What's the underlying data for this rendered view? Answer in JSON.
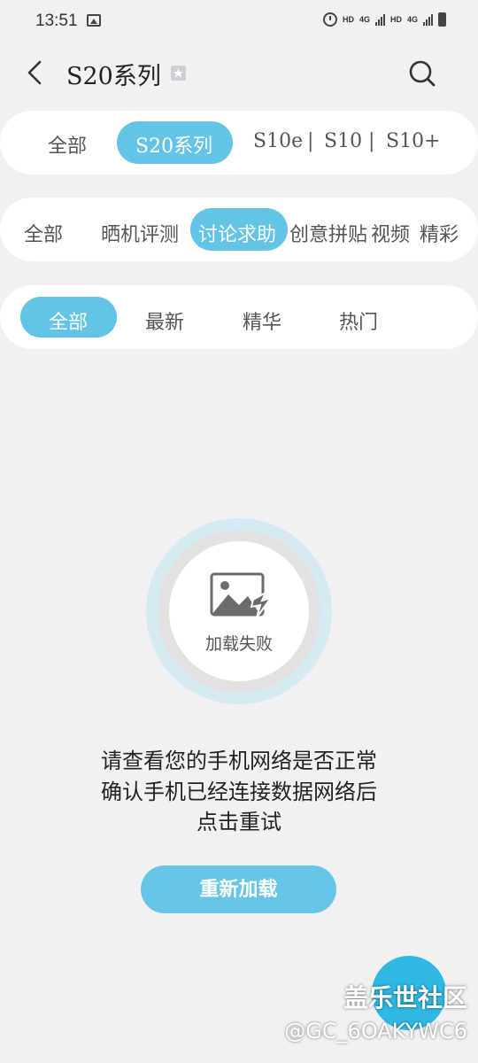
{
  "status_bar": {
    "time": "13:51",
    "hd1": "HD",
    "net1": "4G",
    "hd2": "HD",
    "net2": "4G"
  },
  "header": {
    "title": "S20系列",
    "back_icon": "chevron-left-icon",
    "favorite_icon": "star-bookmark-icon",
    "search_icon": "search-icon"
  },
  "series_tabs": {
    "items": [
      "全部",
      "S20系列",
      "S10e",
      "|",
      "S10",
      "|",
      "S10+"
    ],
    "selected": "S20系列"
  },
  "category_tabs": {
    "items": [
      "全部",
      "晒机评测",
      "讨论求助",
      "创意拼贴",
      "视频",
      "精彩"
    ],
    "selected": "讨论求助"
  },
  "sort_tabs": {
    "items": [
      "全部",
      "最新",
      "精华",
      "热门"
    ],
    "selected": "全部"
  },
  "error": {
    "image_label": "加载失败",
    "line1": "请查看您的手机网络是否正常",
    "line2": "确认手机已经连接数据网络后",
    "line3": "点击重试",
    "retry_button": "重新加载"
  },
  "watermark": {
    "brand": "盖乐世社区",
    "user": "@GC_6OAKYWC6"
  },
  "colors": {
    "accent": "#63c4e8",
    "fab": "#2fb8e3",
    "background": "#f1f1f3"
  }
}
